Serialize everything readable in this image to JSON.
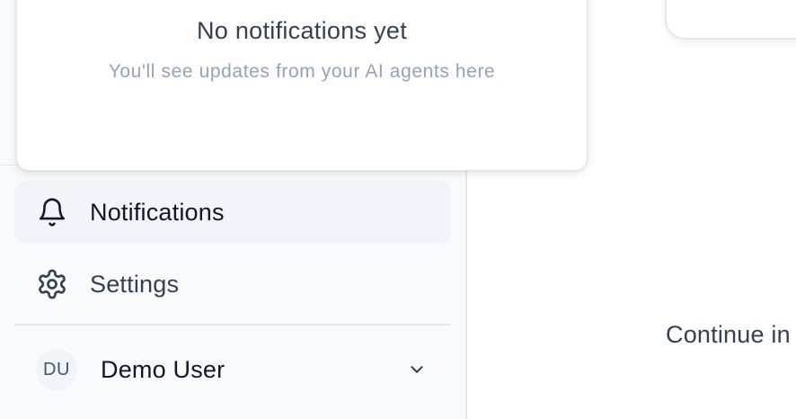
{
  "notifications_panel": {
    "empty_title": "No notifications yet",
    "empty_subtitle": "You'll see updates from your AI agents here"
  },
  "sidebar": {
    "items": [
      {
        "label": "Notifications",
        "icon": "bell-icon",
        "active": true
      },
      {
        "label": "Settings",
        "icon": "gear-icon",
        "active": false
      }
    ],
    "user": {
      "initials": "DU",
      "name": "Demo User"
    }
  },
  "main": {
    "continue_text": "Continue in"
  },
  "colors": {
    "sidebar_bg": "#f8fafc",
    "active_item_bg": "#f1f5f9",
    "border": "#e5e7eb",
    "text_primary": "#0f172a",
    "text_secondary": "#334155",
    "text_muted": "#94a3b8"
  }
}
